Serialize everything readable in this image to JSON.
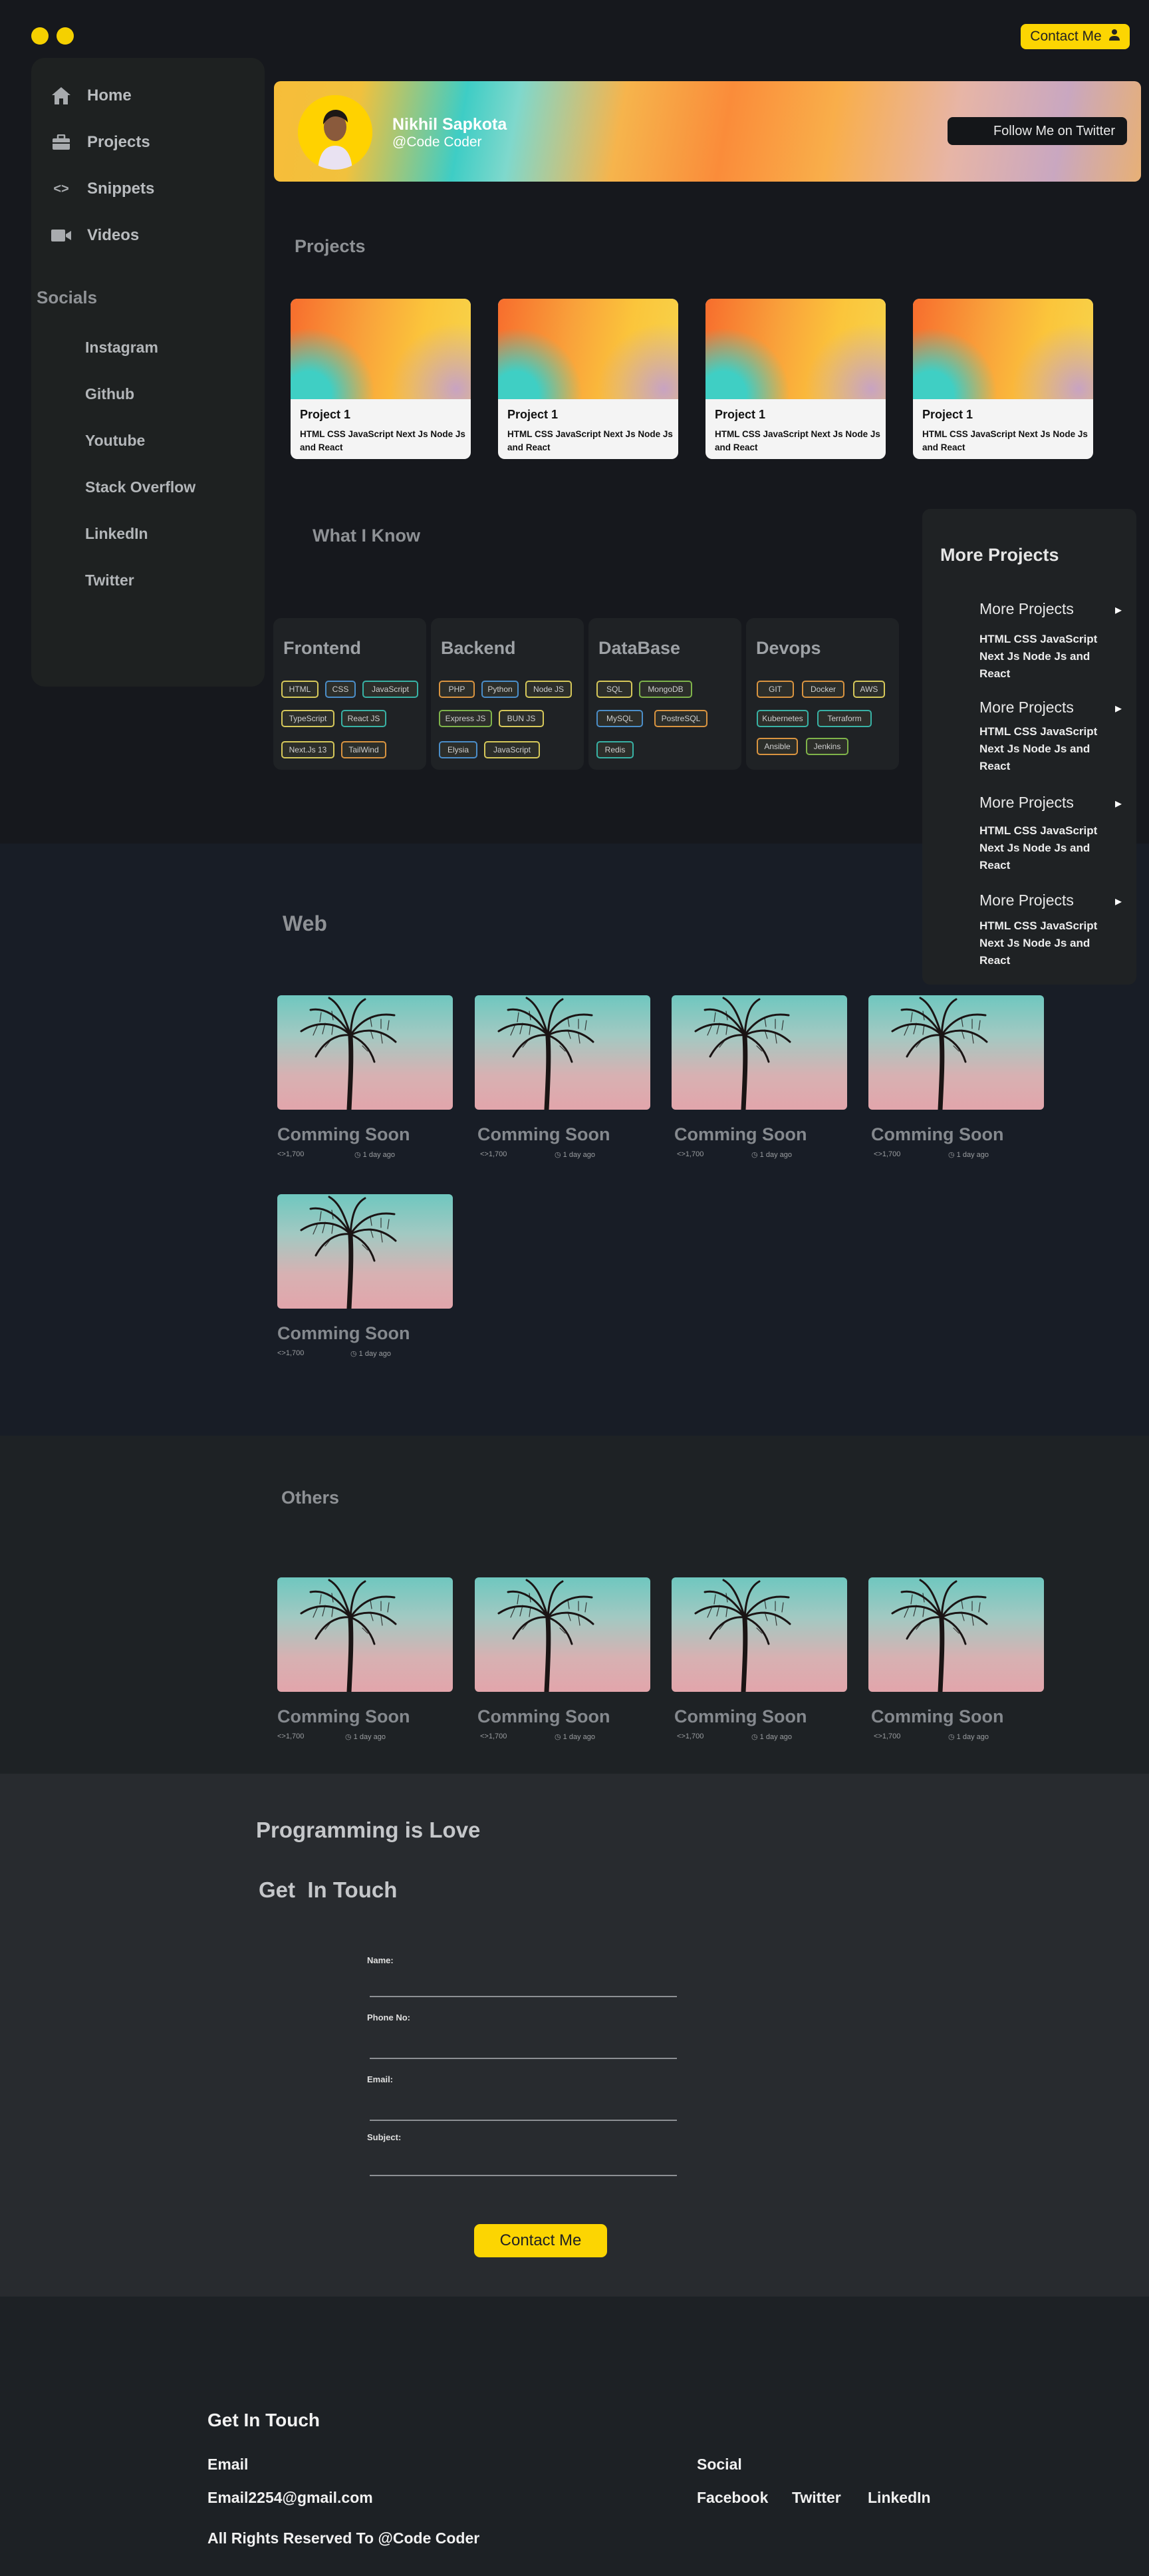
{
  "header": {
    "contact_label": "Contact Me"
  },
  "sidebar": {
    "nav": [
      {
        "label": "Home",
        "icon": "home-icon"
      },
      {
        "label": "Projects",
        "icon": "briefcase-icon"
      },
      {
        "label": "Snippets",
        "icon": "code-icon"
      },
      {
        "label": "Videos",
        "icon": "video-icon"
      }
    ],
    "socials_heading": "Socials",
    "socials": [
      "Instagram",
      "Github",
      "Youtube",
      "Stack Overflow",
      "LinkedIn",
      "Twitter"
    ]
  },
  "profile": {
    "name": "Nikhil Sapkota",
    "handle": "@Code Coder",
    "follow_label": "Follow Me on Twitter"
  },
  "projects": {
    "heading": "Projects",
    "items": [
      {
        "title": "Project 1",
        "desc": "HTML CSS JavaScript Next Js Node Js and React"
      },
      {
        "title": "Project 1",
        "desc": "HTML CSS JavaScript Next Js Node Js and React"
      },
      {
        "title": "Project 1",
        "desc": "HTML CSS JavaScript Next Js Node Js and React"
      },
      {
        "title": "Project 1",
        "desc": "HTML CSS JavaScript Next Js Node Js and React"
      }
    ]
  },
  "skills": {
    "heading": "What I Know",
    "groups": [
      {
        "title": "Frontend",
        "tags": [
          "HTML",
          "CSS",
          "JavaScript",
          "TypeScript",
          "React JS",
          "Next.Js 13",
          "TailWind"
        ]
      },
      {
        "title": "Backend",
        "tags": [
          "PHP",
          "Python",
          "Node JS",
          "Express JS",
          "BUN JS",
          "Elysia",
          "JavaScript"
        ]
      },
      {
        "title": "DataBase",
        "tags": [
          "SQL",
          "MongoDB",
          "MySQL",
          "PostreSQL",
          "Redis"
        ]
      },
      {
        "title": "Devops",
        "tags": [
          "GIT",
          "Docker",
          "AWS",
          "Kubernetes",
          "Terraform",
          "Ansible",
          "Jenkins"
        ]
      }
    ]
  },
  "more_projects": {
    "heading": "More Projects",
    "items": [
      {
        "title": "More Projects",
        "desc": "HTML CSS JavaScript Next Js Node Js and React"
      },
      {
        "title": "More Projects",
        "desc": "HTML CSS JavaScript Next Js Node Js and React"
      },
      {
        "title": "More Projects",
        "desc": "HTML CSS JavaScript Next Js Node Js and React"
      },
      {
        "title": "More Projects",
        "desc": "HTML CSS JavaScript Next Js Node Js and React"
      }
    ]
  },
  "web": {
    "heading": "Web",
    "items": [
      {
        "title": "Comming Soon",
        "views": "1,700",
        "time": "1 day ago"
      },
      {
        "title": "Comming Soon",
        "views": "1,700",
        "time": "1 day ago"
      },
      {
        "title": "Comming Soon",
        "views": "1,700",
        "time": "1 day ago"
      },
      {
        "title": "Comming Soon",
        "views": "1,700",
        "time": "1 day ago"
      },
      {
        "title": "Comming Soon",
        "views": "1,700",
        "time": "1 day ago"
      }
    ]
  },
  "others": {
    "heading": "Others",
    "items": [
      {
        "title": "Comming Soon",
        "views": "1,700",
        "time": "1 day ago"
      },
      {
        "title": "Comming Soon",
        "views": "1,700",
        "time": "1 day ago"
      },
      {
        "title": "Comming Soon",
        "views": "1,700",
        "time": "1 day ago"
      },
      {
        "title": "Comming Soon",
        "views": "1,700",
        "time": "1 day ago"
      }
    ]
  },
  "contact": {
    "tagline": "Programming is Love",
    "heading": "Get  In Touch",
    "fields": {
      "name": "Name:",
      "phone": "Phone No:",
      "email": "Email:",
      "subject": "Subject:"
    },
    "submit_label": "Contact Me"
  },
  "footer": {
    "heading": "Get In Touch",
    "email_label": "Email",
    "email": "Email2254@gmail.com",
    "rights": "All Rights Reserved To @Code Coder",
    "social_label": "Social",
    "links": [
      "Facebook",
      "Twitter",
      "LinkedIn"
    ]
  },
  "colors": {
    "accent": "#fcd502",
    "background": "#16181d",
    "card": "#1f2225"
  }
}
